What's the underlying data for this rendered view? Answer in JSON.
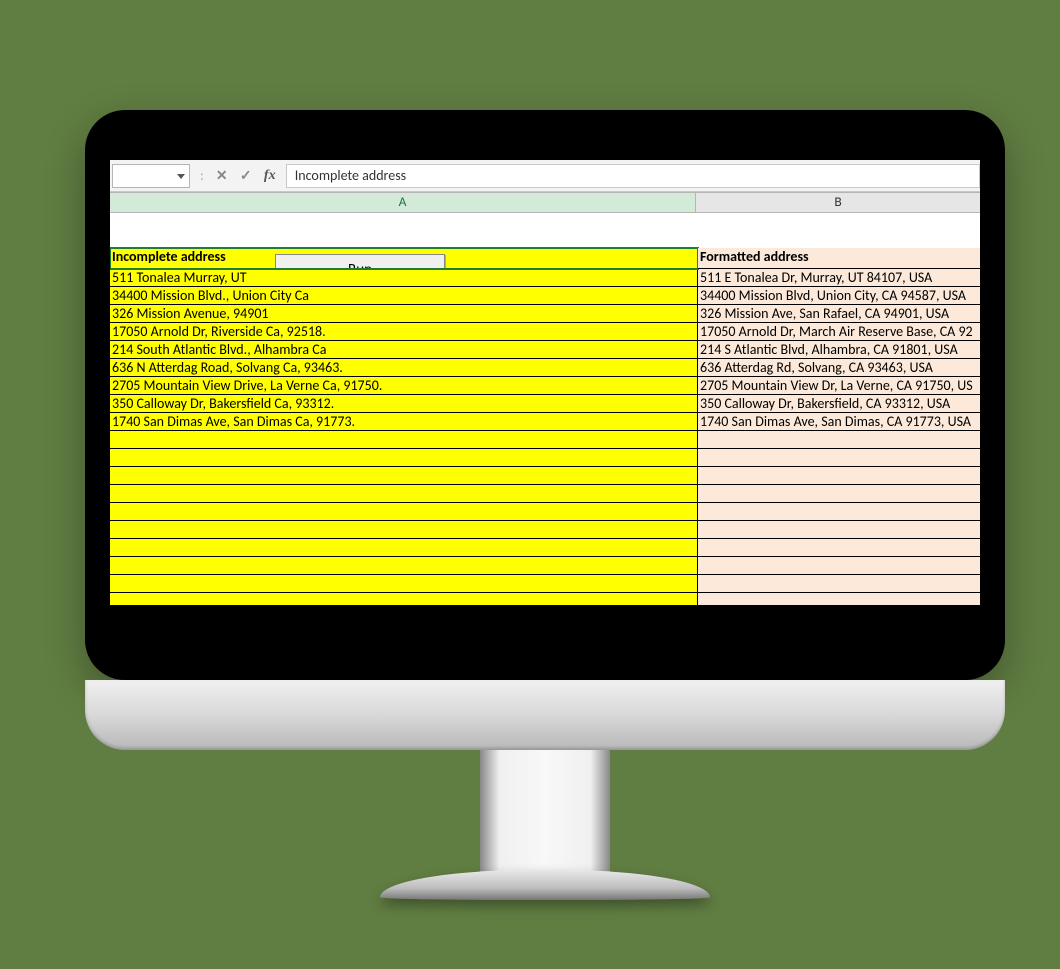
{
  "formulaBar": {
    "nameBox": "",
    "value": "Incomplete address"
  },
  "columns": {
    "A": "A",
    "B": "B"
  },
  "runButton": "Run",
  "headers": {
    "a": "Incomplete address",
    "b": "Formatted address"
  },
  "rows": [
    {
      "a": "511 Tonalea  Murray, UT",
      "b": "511 E Tonalea Dr, Murray, UT 84107, USA"
    },
    {
      "a": "34400 Mission Blvd., Union City Ca",
      "b": "34400 Mission Blvd, Union City, CA 94587, USA"
    },
    {
      "a": "326 Mission Avenue, 94901",
      "b": "326 Mission Ave, San Rafael, CA 94901, USA"
    },
    {
      "a": "17050 Arnold Dr, Riverside Ca, 92518.",
      "b": "17050 Arnold Dr, March Air Reserve Base, CA 92"
    },
    {
      "a": "214 South Atlantic Blvd., Alhambra Ca",
      "b": "214 S Atlantic Blvd, Alhambra, CA 91801, USA"
    },
    {
      "a": "636 N Atterdag Road, Solvang Ca, 93463.",
      "b": "636 Atterdag Rd, Solvang, CA 93463, USA"
    },
    {
      "a": "2705 Mountain View Drive, La Verne Ca, 91750.",
      "b": "2705 Mountain View Dr, La Verne, CA 91750, US"
    },
    {
      "a": "350 Calloway Dr, Bakersfield Ca, 93312.",
      "b": "350 Calloway Dr, Bakersfield, CA 93312, USA"
    },
    {
      "a": "1740 San Dimas Ave, San Dimas Ca, 91773.",
      "b": "1740 San Dimas Ave, San Dimas, CA 91773, USA"
    },
    {
      "a": "",
      "b": ""
    },
    {
      "a": "",
      "b": ""
    },
    {
      "a": "",
      "b": ""
    },
    {
      "a": "",
      "b": ""
    },
    {
      "a": "",
      "b": ""
    },
    {
      "a": "",
      "b": ""
    },
    {
      "a": "",
      "b": ""
    },
    {
      "a": "",
      "b": ""
    },
    {
      "a": "",
      "b": ""
    },
    {
      "a": "",
      "b": ""
    },
    {
      "a": "",
      "b": ""
    }
  ]
}
